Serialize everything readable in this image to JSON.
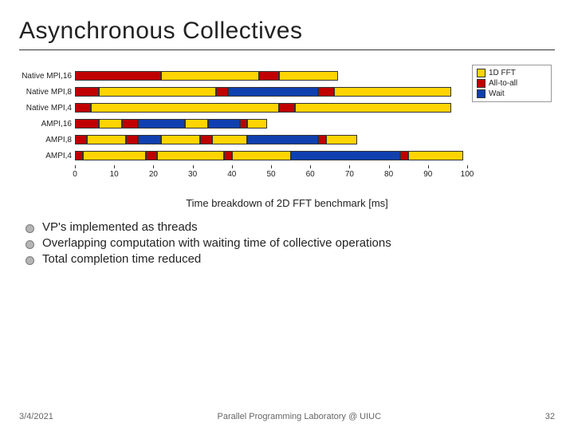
{
  "title": "Asynchronous Collectives",
  "chart_data": {
    "type": "bar",
    "orientation": "horizontal",
    "stacked": true,
    "xlabel": "",
    "ylabel": "",
    "xlim": [
      0,
      100
    ],
    "x_ticks": [
      0,
      10,
      20,
      30,
      40,
      50,
      60,
      70,
      80,
      90,
      100
    ],
    "legend_position": "right",
    "series_palette": {
      "1D FFT": "#ffd400",
      "All-to-all": "#c00000",
      "Wait": "#1040b0"
    },
    "categories": [
      "Native MPI,16",
      "Native MPI,8",
      "Native MPI,4",
      "AMPI,16",
      "AMPI,8",
      "AMPI,4"
    ],
    "legend": [
      "1D FFT",
      "All-to-all",
      "Wait"
    ],
    "segments": [
      [
        [
          "All-to-all",
          22
        ],
        [
          "1D FFT",
          25
        ],
        [
          "All-to-all",
          5
        ],
        [
          "1D FFT",
          15
        ]
      ],
      [
        [
          "All-to-all",
          6
        ],
        [
          "1D FFT",
          30
        ],
        [
          "All-to-all",
          3
        ],
        [
          "Wait",
          23
        ],
        [
          "All-to-all",
          4
        ],
        [
          "1D FFT",
          30
        ]
      ],
      [
        [
          "All-to-all",
          4
        ],
        [
          "1D FFT",
          48
        ],
        [
          "All-to-all",
          4
        ],
        [
          "1D FFT",
          40
        ]
      ],
      [
        [
          "All-to-all",
          6
        ],
        [
          "1D FFT",
          6
        ],
        [
          "All-to-all",
          4
        ],
        [
          "Wait",
          12
        ],
        [
          "1D FFT",
          6
        ],
        [
          "Wait",
          8
        ],
        [
          "All-to-all",
          2
        ],
        [
          "1D FFT",
          5
        ]
      ],
      [
        [
          "All-to-all",
          3
        ],
        [
          "1D FFT",
          10
        ],
        [
          "All-to-all",
          3
        ],
        [
          "Wait",
          6
        ],
        [
          "1D FFT",
          10
        ],
        [
          "All-to-all",
          3
        ],
        [
          "1D FFT",
          9
        ],
        [
          "Wait",
          18
        ],
        [
          "All-to-all",
          2
        ],
        [
          "1D FFT",
          8
        ]
      ],
      [
        [
          "All-to-all",
          2
        ],
        [
          "1D FFT",
          16
        ],
        [
          "All-to-all",
          3
        ],
        [
          "1D FFT",
          17
        ],
        [
          "All-to-all",
          2
        ],
        [
          "1D FFT",
          15
        ],
        [
          "Wait",
          28
        ],
        [
          "All-to-all",
          2
        ],
        [
          "1D FFT",
          14
        ]
      ]
    ]
  },
  "chart_subtitle": "Time breakdown of 2D FFT benchmark [ms]",
  "bullets": [
    "VP's implemented as threads",
    "Overlapping computation with waiting time of collective operations",
    "Total completion time reduced"
  ],
  "footer": {
    "date": "3/4/2021",
    "lab": "Parallel Programming Laboratory @ UIUC",
    "page": "32"
  }
}
